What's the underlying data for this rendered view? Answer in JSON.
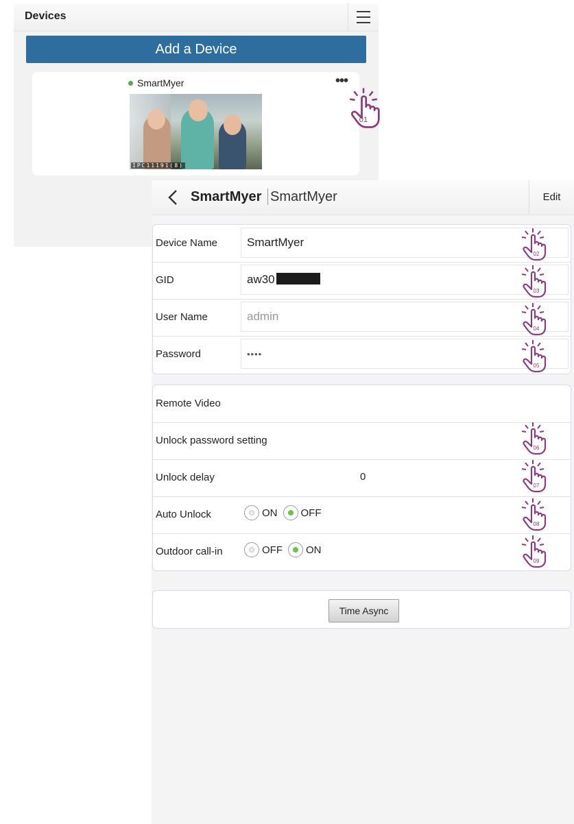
{
  "devices_screen": {
    "title": "Devices",
    "add_button": "Add a Device",
    "device": {
      "name": "SmartMyer",
      "status_color": "#4caf50",
      "camera_label": "IPC11191(8)"
    }
  },
  "detail_screen": {
    "header": {
      "bold_title": "SmartMyer",
      "title": "SmartMyer",
      "edit_label": "Edit"
    },
    "fields": [
      {
        "label": "Device Name",
        "value": "SmartMyer"
      },
      {
        "label": "GID",
        "value": "aw30"
      },
      {
        "label": "User Name",
        "placeholder": "admin"
      },
      {
        "label": "Password",
        "value": "••••"
      }
    ],
    "settings": {
      "remote_video": "Remote Video",
      "unlock_password": "Unlock password setting",
      "unlock_delay": {
        "label": "Unlock delay",
        "value": "0"
      },
      "auto_unlock": {
        "label": "Auto Unlock",
        "opt1": "ON",
        "opt2": "OFF",
        "selected": "OFF"
      },
      "outdoor_call": {
        "label": "Outdoor call-in",
        "opt1": "OFF",
        "opt2": "ON",
        "selected": "ON"
      }
    },
    "time_async_label": "Time Async"
  },
  "annotations": [
    "01",
    "02",
    "03",
    "04",
    "05",
    "06",
    "07",
    "08",
    "09"
  ],
  "colors": {
    "accent": "#2e6e9e",
    "hand": "#8c3a7e",
    "radio_selected": "#6cc24a"
  }
}
